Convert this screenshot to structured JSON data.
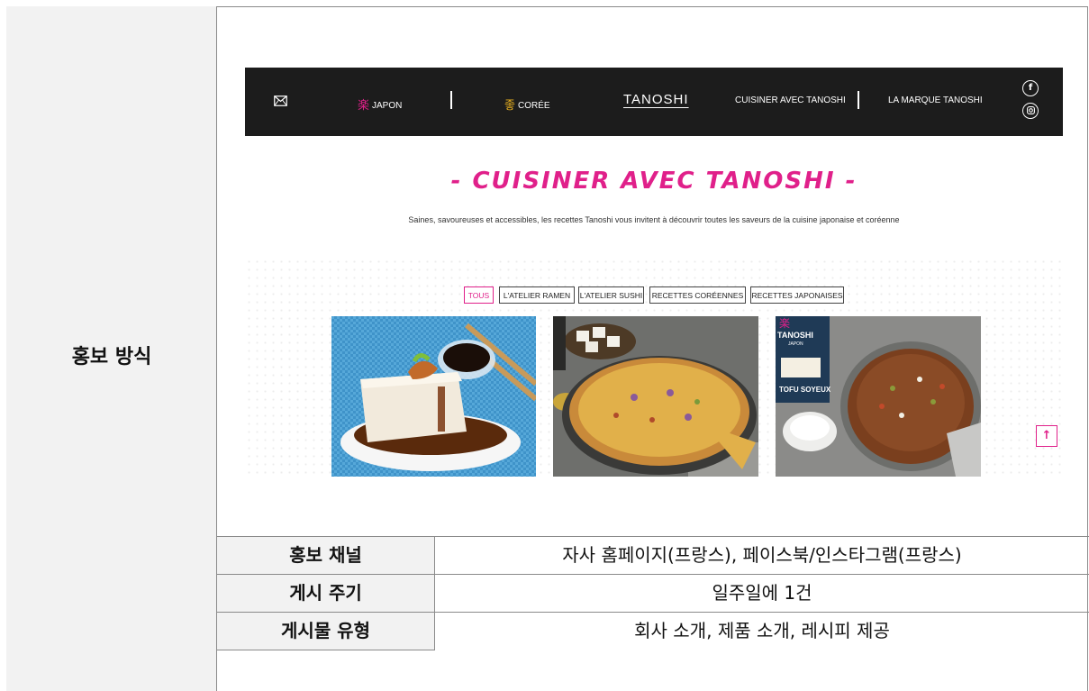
{
  "left_header": {
    "label": "홍보 방식"
  },
  "site": {
    "nav": {
      "japon": "JAPON",
      "coree": "CORÉE",
      "brand": "TANOSHI",
      "cuisiner": "CUISINER AVEC TANOSHI",
      "marque": "LA MARQUE TANOSHI",
      "japon_kanji": "楽",
      "coree_kanji": "좋"
    },
    "hero_title": "- CUISINER AVEC TANOSHI -",
    "hero_subtitle": "Saines, savoureuses et accessibles, les recettes Tanoshi vous invitent à découvrir toutes les saveurs de la cuisine japonaise et coréenne",
    "filters": [
      "TOUS",
      "L'ATELIER RAMEN",
      "L'ATELIER SUSHI",
      "RECETTES CORÉENNES",
      "RECETTES JAPONAISES"
    ],
    "product_box": {
      "brand": "TANOSHI",
      "sub": "JAPON",
      "product": "TOFU SOYEUX"
    },
    "colors": {
      "accent": "#e0208a",
      "nav_bg": "#1c1c1c"
    }
  },
  "table": {
    "rows": [
      {
        "head": "홍보 채널",
        "value": "자사 홈페이지(프랑스), 페이스북/인스타그램(프랑스)"
      },
      {
        "head": "게시 주기",
        "value": "일주일에 1건"
      },
      {
        "head": "게시물 유형",
        "value": "회사 소개, 제품 소개, 레시피 제공"
      }
    ]
  }
}
